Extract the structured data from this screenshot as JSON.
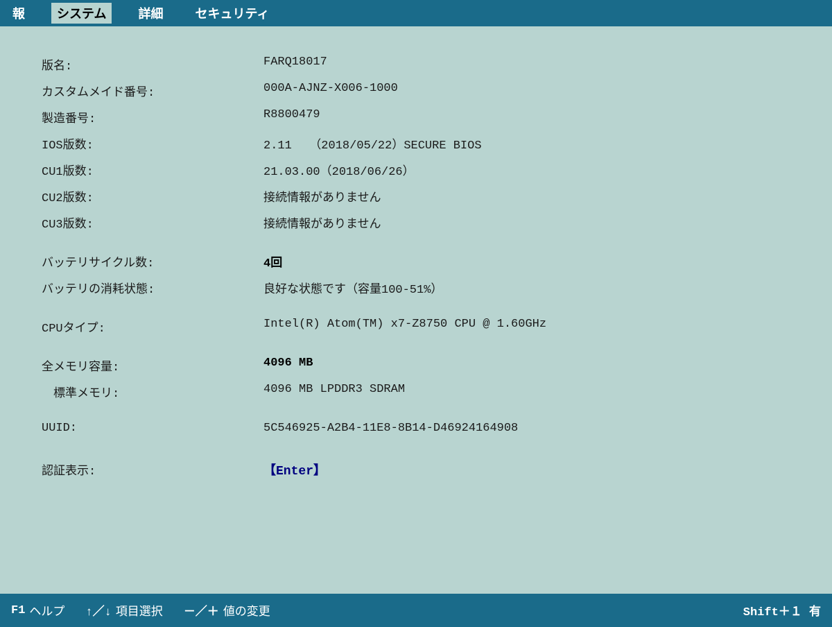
{
  "menuBar": {
    "items": [
      {
        "label": "報",
        "id": "menu-report",
        "active": false
      },
      {
        "label": "システム",
        "id": "menu-system",
        "active": true
      },
      {
        "label": "詳細",
        "id": "menu-detail",
        "active": false
      },
      {
        "label": "セキュリティ",
        "id": "menu-security",
        "active": false
      }
    ]
  },
  "fields": [
    {
      "label": "版名:",
      "value": "FARQ18017",
      "extraGap": true
    },
    {
      "label": "カスタムメイド番号:",
      "value": "000A-AJNZ-X006-1000",
      "extraGap": false
    },
    {
      "label": "製造番号:",
      "value": "R8800479",
      "extraGap": false
    },
    {
      "label": "IOS版数:",
      "value": "2.11　　（2018/05/22）SECURE BIOS",
      "extraGap": false
    },
    {
      "label": "CU1版数:",
      "value": "21.03.00（2018/06/26）",
      "extraGap": false
    },
    {
      "label": "CU2版数:",
      "value": "接続情報がありません",
      "extraGap": false
    },
    {
      "label": "CU3版数:",
      "value": "接続情報がありません",
      "extraGap": false
    },
    {
      "label": "",
      "value": "",
      "extraGap": false,
      "blank": true
    },
    {
      "label": "バッテリサイクル数:",
      "value": "4回",
      "extraGap": true
    },
    {
      "label": "バッテリの消耗状態:",
      "value": "良好な状態です（容量100-51%）",
      "extraGap": false
    },
    {
      "label": "",
      "value": "",
      "extraGap": false,
      "blank": true
    },
    {
      "label": "CPUタイプ:",
      "value": "Intel(R) Atom(TM) x7-Z8750  CPU @ 1.60GHz",
      "extraGap": true
    },
    {
      "label": "",
      "value": "",
      "extraGap": false,
      "blank": true
    },
    {
      "label": "全メモリ容量:",
      "value": "4096 MB",
      "extraGap": true
    },
    {
      "label": "　標準メモリ:",
      "value": "4096 MB LPDDR3 SDRAM",
      "extraGap": false
    },
    {
      "label": "",
      "value": "",
      "extraGap": false,
      "blank": true
    },
    {
      "label": "UUID:",
      "value": "5C546925-A2B4-11E8-8B14-D46924164908",
      "extraGap": true
    },
    {
      "label": "",
      "value": "",
      "extraGap": false,
      "blank": true
    },
    {
      "label": "認証表示:",
      "value": "【Enter】",
      "extraGap": true,
      "highlight": true
    }
  ],
  "statusBar": {
    "items": [
      {
        "key": "F1",
        "desc": "ヘルプ"
      },
      {
        "key": "↑／↓",
        "desc": "項目選択"
      },
      {
        "key": "-／+",
        "desc": "値の変更"
      },
      {
        "key": "Shift＋１",
        "desc": "有"
      }
    ]
  }
}
